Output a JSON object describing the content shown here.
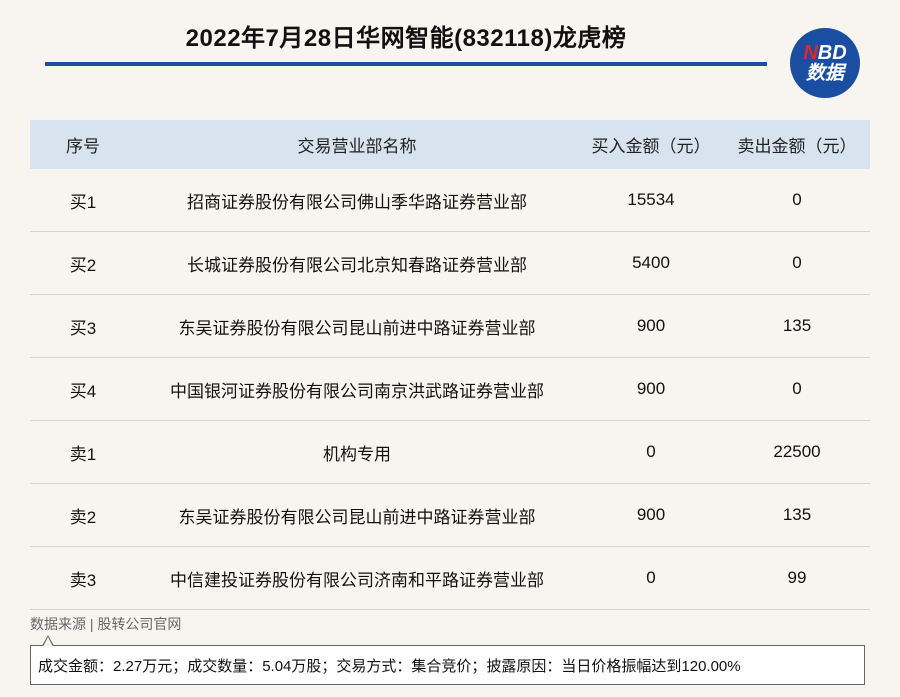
{
  "header": {
    "title": "2022年7月28日华网智能(832118)龙虎榜",
    "logo_top": "NBD",
    "logo_top_first": "N",
    "logo_top_rest": "BD",
    "logo_bottom": "数据",
    "colors": {
      "rule": "#1e4f9c",
      "logo_bg": "#1a4ea0",
      "logo_accent": "#e3262c",
      "header_row": "#d7e3ef"
    }
  },
  "table": {
    "columns": [
      "序号",
      "交易营业部名称",
      "买入金额（元）",
      "卖出金额（元）"
    ],
    "rows": [
      {
        "no": "买1",
        "name": "招商证券股份有限公司佛山季华路证券营业部",
        "buy": "15534",
        "sell": "0"
      },
      {
        "no": "买2",
        "name": "长城证券股份有限公司北京知春路证券营业部",
        "buy": "5400",
        "sell": "0"
      },
      {
        "no": "买3",
        "name": "东吴证券股份有限公司昆山前进中路证券营业部",
        "buy": "900",
        "sell": "135"
      },
      {
        "no": "买4",
        "name": "中国银河证券股份有限公司南京洪武路证券营业部",
        "buy": "900",
        "sell": "0"
      },
      {
        "no": "卖1",
        "name": "机构专用",
        "buy": "0",
        "sell": "22500"
      },
      {
        "no": "卖2",
        "name": "东吴证券股份有限公司昆山前进中路证券营业部",
        "buy": "900",
        "sell": "135"
      },
      {
        "no": "卖3",
        "name": "中信建投证券股份有限公司济南和平路证券营业部",
        "buy": "0",
        "sell": "99"
      }
    ]
  },
  "footer": {
    "source": "数据来源 | 股转公司官网",
    "note": "成交金额：2.27万元；成交数量：5.04万股；交易方式：集合竞价；披露原因：当日价格振幅达到120.00%"
  }
}
